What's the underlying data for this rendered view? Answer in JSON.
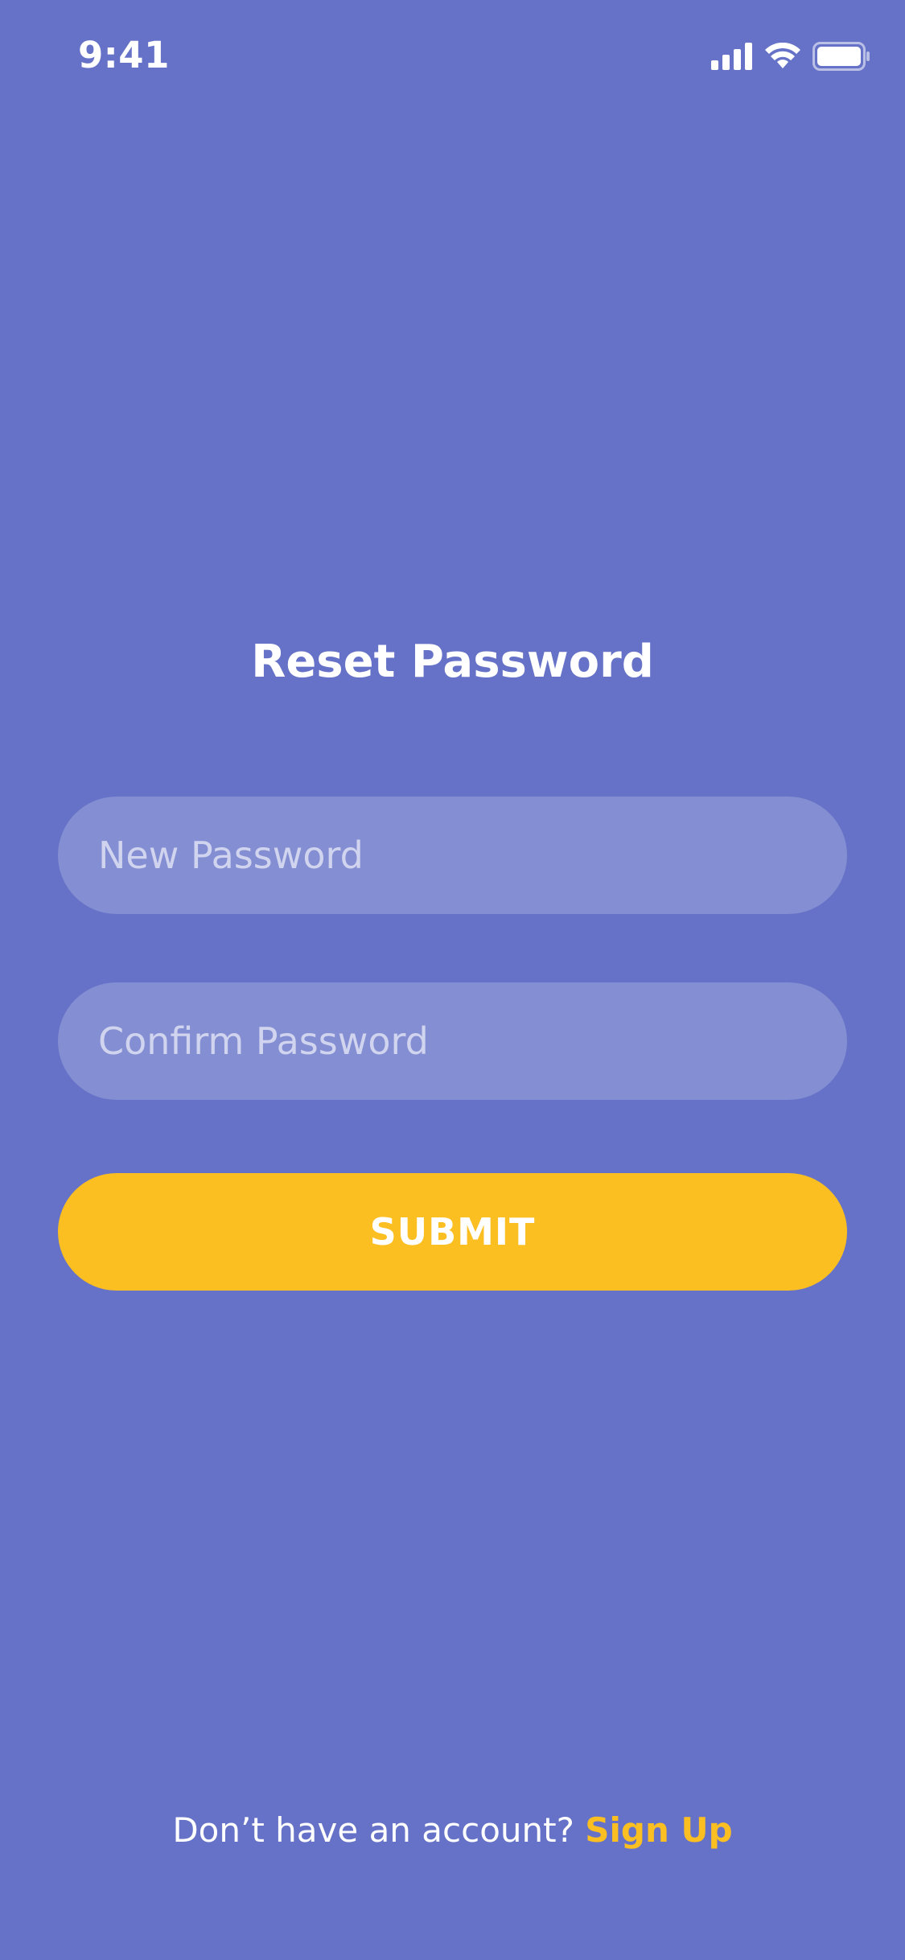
{
  "status_bar": {
    "time": "9:41"
  },
  "colors": {
    "background": "#6672C7",
    "accent": "#FBBF21",
    "field_bg": "rgba(255,255,255,0.20)",
    "text": "#FFFFFF"
  },
  "icons": {
    "signal": "cellular-signal-icon",
    "wifi": "wifi-icon",
    "battery": "battery-icon"
  },
  "page": {
    "title": "Reset Password"
  },
  "form": {
    "new_password": {
      "placeholder": "New Password",
      "value": ""
    },
    "confirm_password": {
      "placeholder": "Confirm Password",
      "value": ""
    },
    "submit_label": "SUBMIT"
  },
  "footer": {
    "prompt": "Don’t have an account?",
    "link_label": "Sign Up"
  }
}
